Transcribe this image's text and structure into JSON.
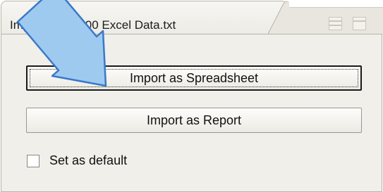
{
  "window": {
    "title": "Importing file: 00 Excel Data.txt"
  },
  "buttons": {
    "import_spreadsheet": "Import as Spreadsheet",
    "import_report": "Import as Report"
  },
  "checkbox": {
    "label": "Set as default",
    "checked": false
  },
  "icons": {
    "pointer": "arrow-icon",
    "layout_rows": "layout-rows-icon",
    "layout_split": "layout-split-icon"
  },
  "colors": {
    "panel": "#f0efe9",
    "border": "#b7b4a6",
    "pointer_fill": "#9fcaf0",
    "pointer_stroke": "#3a78c8"
  }
}
